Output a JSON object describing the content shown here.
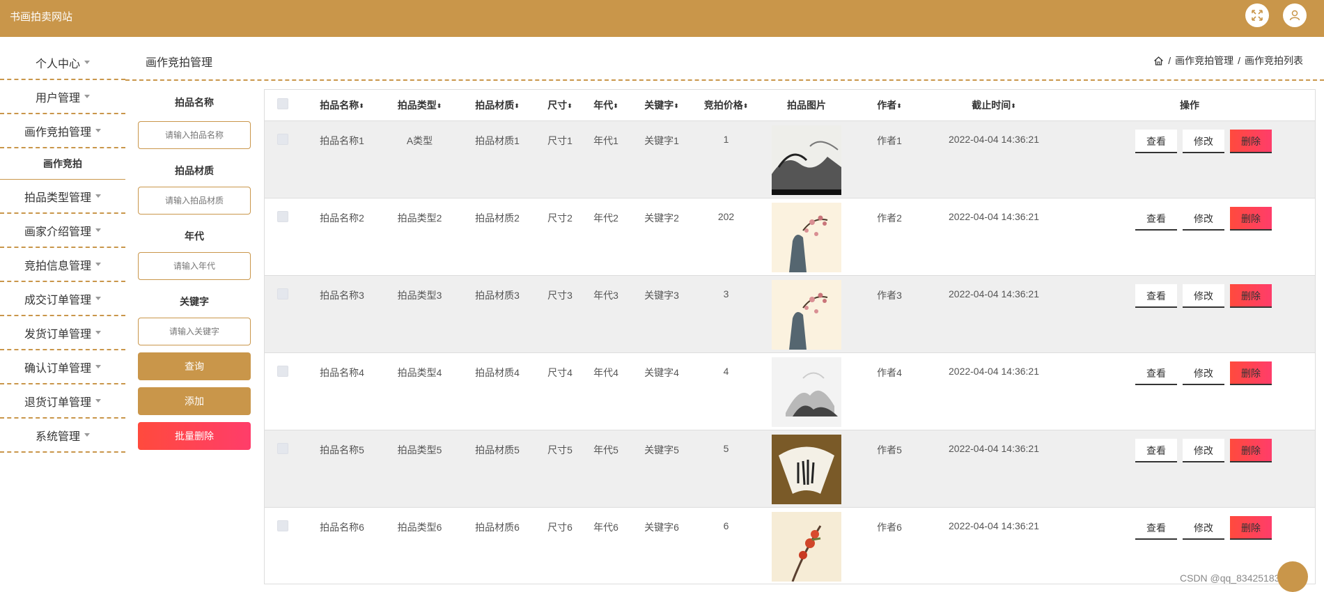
{
  "header": {
    "brand": "书画拍卖网站",
    "icons": [
      "fullscreen-icon",
      "user-icon"
    ]
  },
  "sidebar": {
    "items": [
      {
        "label": "个人中心"
      },
      {
        "label": "用户管理"
      },
      {
        "label": "画作竞拍管理"
      },
      {
        "label": "画作竞拍",
        "sub": true
      },
      {
        "label": "拍品类型管理"
      },
      {
        "label": "画家介绍管理"
      },
      {
        "label": "竞拍信息管理"
      },
      {
        "label": "成交订单管理"
      },
      {
        "label": "发货订单管理"
      },
      {
        "label": "确认订单管理"
      },
      {
        "label": "退货订单管理"
      },
      {
        "label": "系统管理"
      }
    ]
  },
  "page": {
    "title": "画作竞拍管理",
    "breadcrumb": [
      "画作竞拍管理",
      "画作竞拍列表"
    ]
  },
  "search": {
    "fields": [
      {
        "label": "拍品名称",
        "placeholder": "请输入拍品名称"
      },
      {
        "label": "拍品材质",
        "placeholder": "请输入拍品材质"
      },
      {
        "label": "年代",
        "placeholder": "请输入年代"
      },
      {
        "label": "关键字",
        "placeholder": "请输入关键字"
      }
    ],
    "query_label": "查询",
    "add_label": "添加",
    "batch_delete_label": "批量删除",
    "colors": {
      "primary": "#c9964a",
      "danger": "#ff4a3d"
    }
  },
  "table": {
    "columns": [
      "拍品名称",
      "拍品类型",
      "拍品材质",
      "尺寸",
      "年代",
      "关键字",
      "竞拍价格",
      "拍品图片",
      "作者",
      "截止时间",
      "操作"
    ],
    "sortable": [
      true,
      true,
      true,
      true,
      true,
      true,
      true,
      false,
      true,
      true,
      false
    ],
    "view_label": "查看",
    "edit_label": "修改",
    "delete_label": "删除",
    "rows": [
      {
        "name": "拍品名称1",
        "type": "A类型",
        "material": "拍品材质1",
        "size": "尺寸1",
        "era": "年代1",
        "keyword": "关键字1",
        "price": "1",
        "author": "作者1",
        "deadline": "2022-04-04 14:36:21",
        "image": "landscape-ink"
      },
      {
        "name": "拍品名称2",
        "type": "拍品类型2",
        "material": "拍品材质2",
        "size": "尺寸2",
        "era": "年代2",
        "keyword": "关键字2",
        "price": "202",
        "author": "作者2",
        "deadline": "2022-04-04 14:36:21",
        "image": "plum-rock"
      },
      {
        "name": "拍品名称3",
        "type": "拍品类型3",
        "material": "拍品材质3",
        "size": "尺寸3",
        "era": "年代3",
        "keyword": "关键字3",
        "price": "3",
        "author": "作者3",
        "deadline": "2022-04-04 14:36:21",
        "image": "plum-rock"
      },
      {
        "name": "拍品名称4",
        "type": "拍品类型4",
        "material": "拍品材质4",
        "size": "尺寸4",
        "era": "年代4",
        "keyword": "关键字4",
        "price": "4",
        "author": "作者4",
        "deadline": "2022-04-04 14:36:21",
        "image": "mountain-mist"
      },
      {
        "name": "拍品名称5",
        "type": "拍品类型5",
        "material": "拍品材质5",
        "size": "尺寸5",
        "era": "年代5",
        "keyword": "关键字5",
        "price": "5",
        "author": "作者5",
        "deadline": "2022-04-04 14:36:21",
        "image": "fan-calligraphy"
      },
      {
        "name": "拍品名称6",
        "type": "拍品类型6",
        "material": "拍品材质6",
        "size": "尺寸6",
        "era": "年代6",
        "keyword": "关键字6",
        "price": "6",
        "author": "作者6",
        "deadline": "2022-04-04 14:36:21",
        "image": "persimmon-branch"
      }
    ]
  },
  "watermark": "CSDN @qq_834251831"
}
